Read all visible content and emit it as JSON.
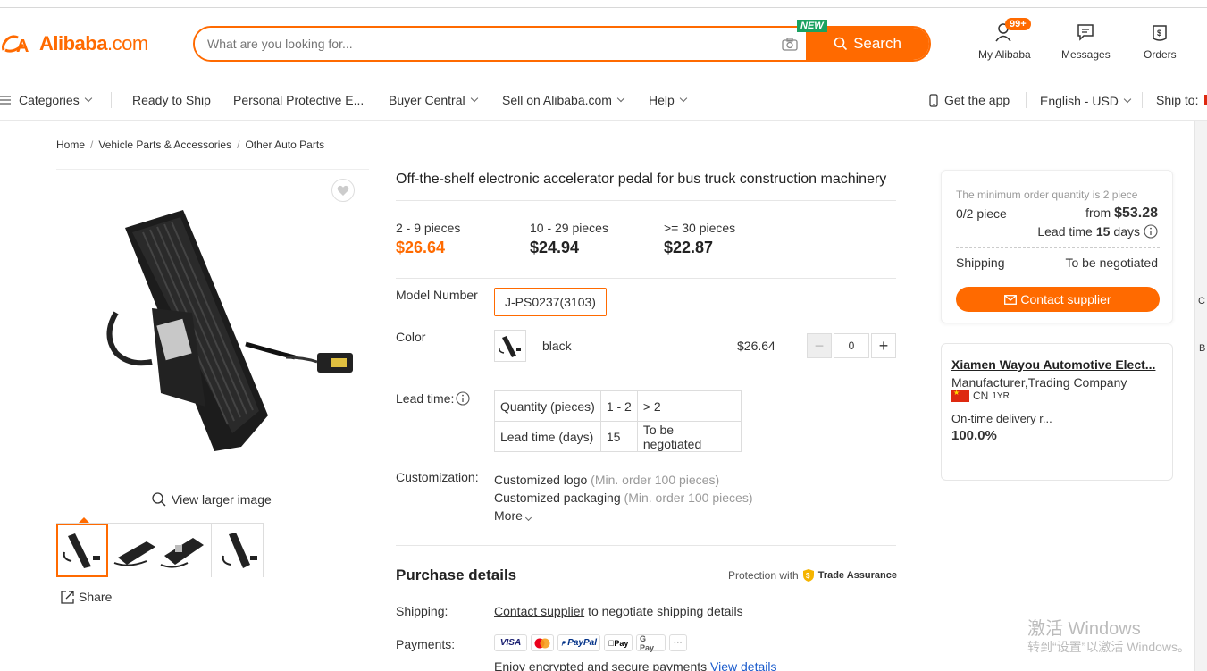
{
  "header": {
    "logo_text": "Alibaba",
    "logo_suffix": ".com",
    "search_placeholder": "What are you looking for...",
    "search_button": "Search",
    "new_badge": "NEW",
    "my_alibaba": "My Alibaba",
    "my_alibaba_badge": "99+",
    "messages": "Messages",
    "orders": "Orders"
  },
  "nav": {
    "categories": "Categories",
    "ready_to_ship": "Ready to Ship",
    "ppe": "Personal Protective E...",
    "buyer_central": "Buyer Central",
    "sell": "Sell on Alibaba.com",
    "help": "Help",
    "get_app": "Get the app",
    "language": "English - USD",
    "ship_to": "Ship to:"
  },
  "breadcrumb": [
    "Home",
    "Vehicle Parts & Accessories",
    "Other Auto Parts"
  ],
  "gallery": {
    "view_larger": "View larger image",
    "share": "Share"
  },
  "product": {
    "title": "Off-the-shelf electronic accelerator pedal for bus truck construction machinery",
    "tiers": [
      {
        "range": "2 - 9 pieces",
        "price": "$26.64"
      },
      {
        "range": "10 - 29 pieces",
        "price": "$24.94"
      },
      {
        "range": ">= 30 pieces",
        "price": "$22.87"
      }
    ],
    "model_label": "Model Number",
    "model_value": "J-PS0237(3103)",
    "color_label": "Color",
    "color_name": "black",
    "color_price": "$26.64",
    "quantity": "0",
    "lead_label": "Lead time:",
    "lead_table": {
      "row1": [
        "Quantity (pieces)",
        "1 - 2",
        "> 2"
      ],
      "row2": [
        "Lead time (days)",
        "15",
        "To be negotiated"
      ]
    },
    "custom_label": "Customization:",
    "custom_logo": "Customized logo",
    "custom_logo_note": "(Min. order 100 pieces)",
    "custom_pack": "Customized packaging",
    "custom_pack_note": "(Min. order 100 pieces)",
    "more": "More"
  },
  "purchase": {
    "title": "Purchase details",
    "protection": "Protection with",
    "trade_assurance": "Trade Assurance",
    "shipping_label": "Shipping:",
    "shipping_link": "Contact supplier",
    "shipping_text": "to negotiate shipping details",
    "payments_label": "Payments:",
    "payment_methods": [
      "VISA",
      "MC",
      "PayPal",
      "Apple Pay",
      "G Pay",
      "···"
    ],
    "enjoy_text": "Enjoy encrypted and secure payments",
    "view_details": "View details"
  },
  "order_card": {
    "min_note": "The minimum order quantity is 2 piece",
    "qty": "0/2 piece",
    "from_label": "from",
    "from_price": "$53.28",
    "lead_prefix": "Lead time",
    "lead_days": "15",
    "lead_suffix": "days",
    "shipping_label": "Shipping",
    "shipping_value": "To be negotiated",
    "contact_button": "Contact supplier"
  },
  "supplier": {
    "name": "Xiamen Wayou Automotive Elect...",
    "type": "Manufacturer,Trading Company",
    "country": "CN",
    "years": "1YR",
    "ontime_label": "On-time delivery r...",
    "ontime_value": "100.0%"
  },
  "watermark": {
    "line1": "激活 Windows",
    "line2": "转到“设置”以激活 Windows。"
  },
  "edge": {
    "c": "C",
    "b": "B"
  },
  "colors": {
    "accent": "#ff6a00",
    "link": "#1a5bcc"
  }
}
